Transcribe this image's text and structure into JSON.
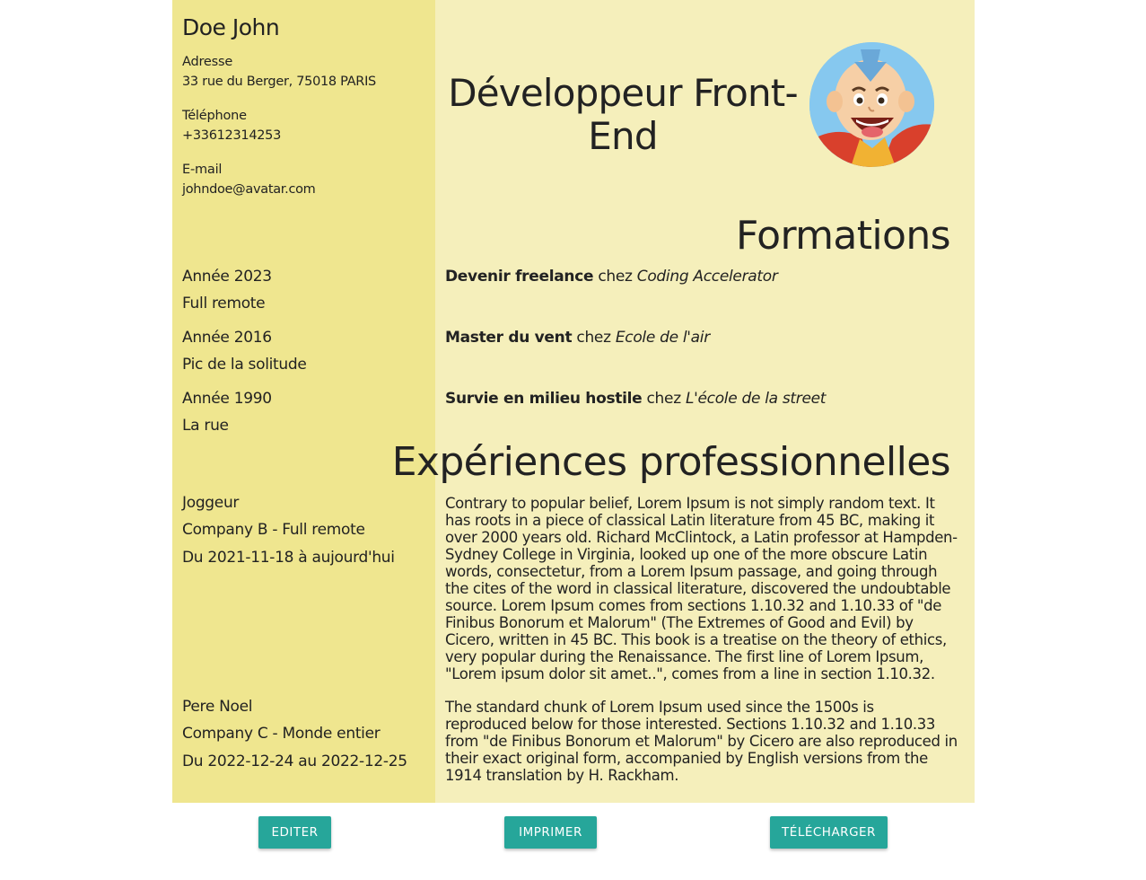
{
  "profile": {
    "name": "Doe John",
    "contacts": [
      {
        "label": "Adresse",
        "value": "33 rue du Berger, 75018 PARIS"
      },
      {
        "label": "Téléphone",
        "value": "+33612314253"
      },
      {
        "label": "E-mail",
        "value": "johndoe@avatar.com"
      }
    ]
  },
  "header": {
    "job_title": "Développeur Front-End",
    "avatar_icon": "avatar-portrait-icon"
  },
  "formations": {
    "title": "Formations",
    "items": [
      {
        "year": "Année 2023",
        "location": "Full remote",
        "diploma": "Devenir freelance",
        "connector": "chez",
        "school": "Coding Accelerator"
      },
      {
        "year": "Année 2016",
        "location": "Pic de la solitude",
        "diploma": "Master du vent",
        "connector": "chez",
        "school": "Ecole de l'air"
      },
      {
        "year": "Année 1990",
        "location": "La rue",
        "diploma": "Survie en milieu hostile",
        "connector": "chez",
        "school": "L'école de la street"
      }
    ]
  },
  "experiences": {
    "title": "Expériences professionnelles",
    "items": [
      {
        "role": "Joggeur",
        "company": "Company B - Full remote",
        "period": "Du 2021-11-18 à aujourd'hui",
        "description": "Contrary to popular belief, Lorem Ipsum is not simply random text. It has roots in a piece of classical Latin literature from 45 BC, making it over 2000 years old. Richard McClintock, a Latin professor at Hampden-Sydney College in Virginia, looked up one of the more obscure Latin words, consectetur, from a Lorem Ipsum passage, and going through the cites of the word in classical literature, discovered the undoubtable source. Lorem Ipsum comes from sections 1.10.32 and 1.10.33 of \"de Finibus Bonorum et Malorum\" (The Extremes of Good and Evil) by Cicero, written in 45 BC. This book is a treatise on the theory of ethics, very popular during the Renaissance. The first line of Lorem Ipsum, \"Lorem ipsum dolor sit amet..\", comes from a line in section 1.10.32."
      },
      {
        "role": "Pere Noel",
        "company": "Company C - Monde entier",
        "period": "Du 2022-12-24 au 2022-12-25",
        "description": "The standard chunk of Lorem Ipsum used since the 1500s is reproduced below for those interested. Sections 1.10.32 and 1.10.33 from \"de Finibus Bonorum et Malorum\" by Cicero are also reproduced in their exact original form, accompanied by English versions from the 1914 translation by H. Rackham."
      }
    ]
  },
  "actions": {
    "edit_label": "Editer",
    "print_label": "Imprimer",
    "download_label": "Télécharger"
  },
  "colors": {
    "left_panel": "#efe68f",
    "right_panel": "#f5efbb",
    "button": "#26a69a"
  }
}
